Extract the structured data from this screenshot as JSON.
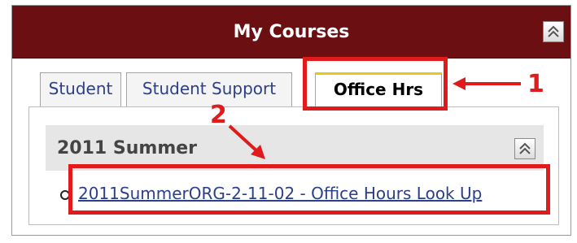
{
  "portlet": {
    "title": "My Courses",
    "collapse_icon": "double-chevron-up-icon"
  },
  "tabs": [
    {
      "label": "Student",
      "active": false
    },
    {
      "label": "Student Support",
      "active": false
    },
    {
      "label": "Office Hrs",
      "active": true
    }
  ],
  "term": {
    "title": "2011 Summer",
    "collapse_icon": "double-chevron-up-icon"
  },
  "courses": [
    {
      "label": "2011SummerORG-2-11-02 - Office Hours Look Up"
    }
  ],
  "annotations": {
    "step1": "1",
    "step2": "2",
    "color": "#e01b1b"
  },
  "colors": {
    "header_bg": "#6b0f12",
    "link": "#2b3f8a",
    "active_tab_accent": "#e6c81a"
  }
}
